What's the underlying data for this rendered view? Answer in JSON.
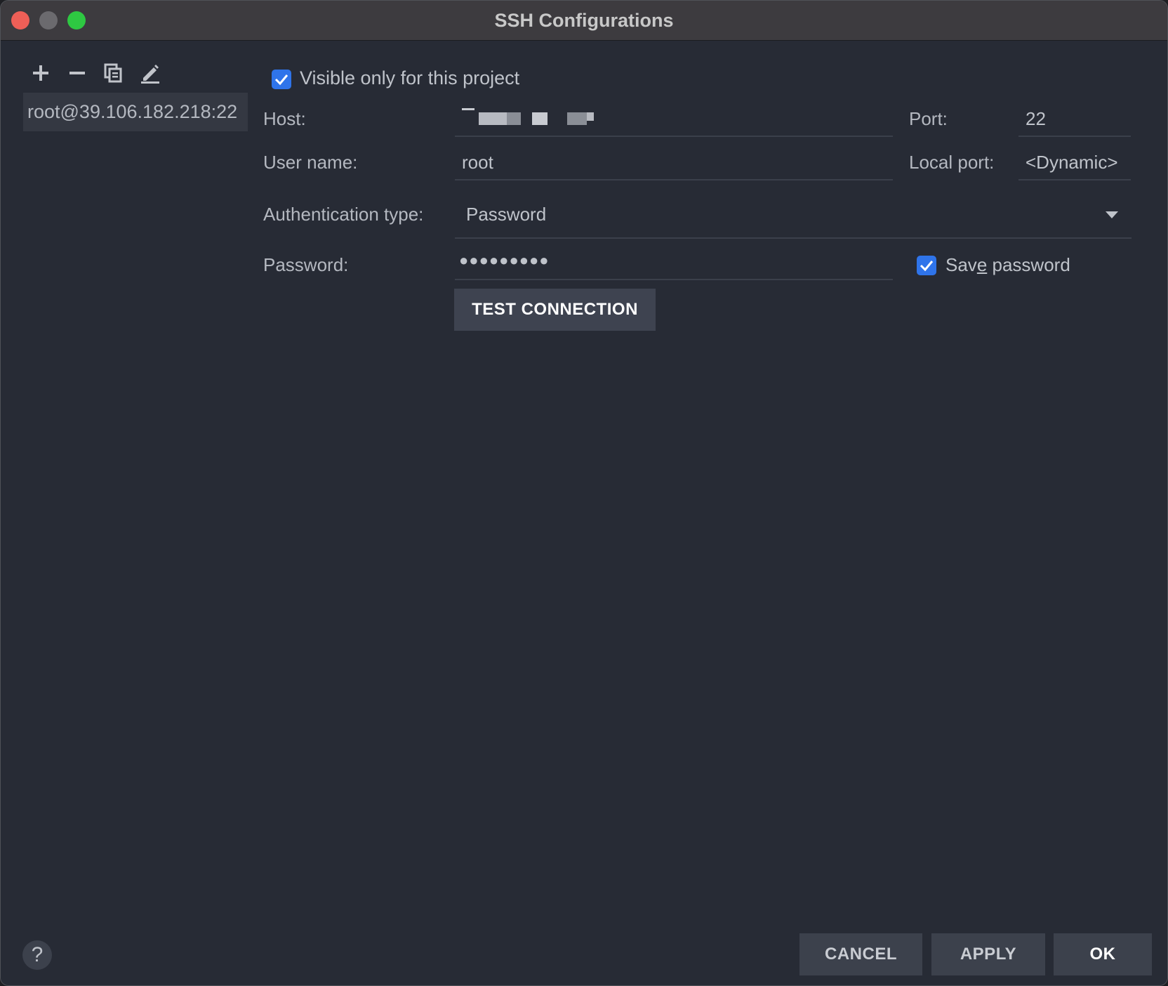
{
  "window": {
    "title": "SSH Configurations"
  },
  "toolbar": {
    "add_icon": "plus-icon",
    "remove_icon": "minus-icon",
    "copy_icon": "copy-icon",
    "edit_icon": "edit-icon"
  },
  "sidebar": {
    "items": [
      {
        "label": "root@39.106.182.218:22"
      }
    ]
  },
  "form": {
    "visible_only_label": "Visible only for this project",
    "visible_only_checked": true,
    "host_label": "Host:",
    "host_value": "",
    "port_label": "Port:",
    "port_value": "22",
    "username_label": "User name:",
    "username_value": "root",
    "local_port_label": "Local port:",
    "local_port_value": "<Dynamic>",
    "auth_label": "Authentication type:",
    "auth_value": "Password",
    "password_label": "Password:",
    "password_value": "●●●●●●●●●",
    "save_password_pre": "Sav",
    "save_password_mnemonic": "e",
    "save_password_post": " password",
    "save_password_checked": true,
    "test_button": "TEST CONNECTION"
  },
  "footer": {
    "help": "?",
    "cancel": "CANCEL",
    "apply": "APPLY",
    "ok": "OK"
  },
  "colors": {
    "accent": "#2f74ea",
    "background": "#272b35",
    "button": "#3c414c"
  }
}
